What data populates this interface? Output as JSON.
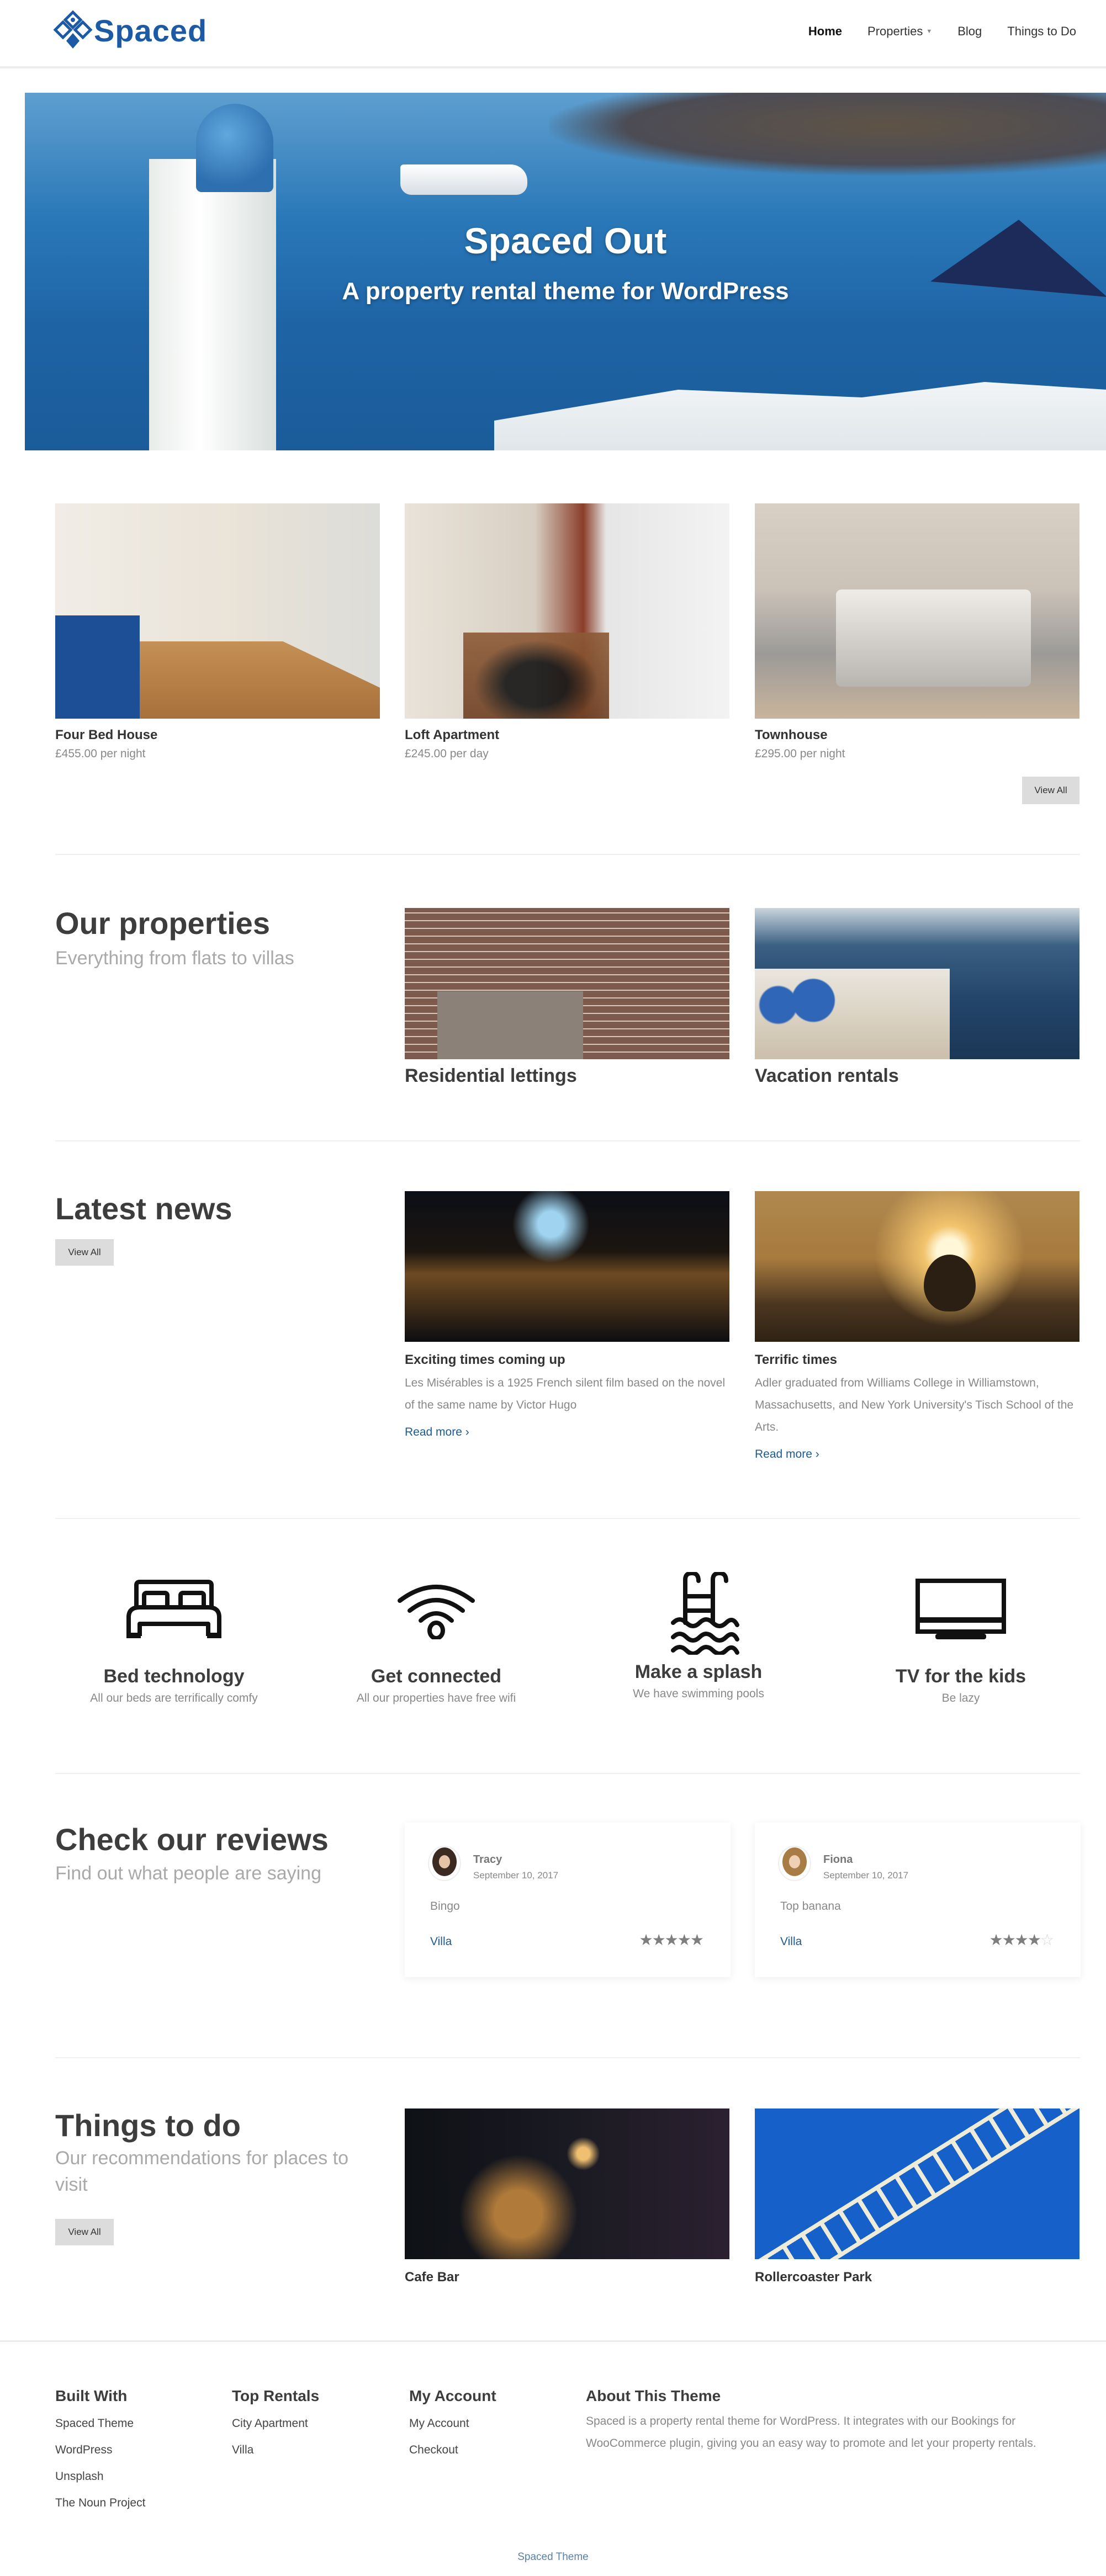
{
  "header": {
    "brand": "Spaced",
    "nav": [
      {
        "label": "Home",
        "active": true
      },
      {
        "label": "Properties",
        "has_dropdown": true
      },
      {
        "label": "Blog"
      },
      {
        "label": "Things to Do"
      }
    ],
    "dropdown_icon": "caret-down-icon"
  },
  "hero": {
    "title": "Spaced Out",
    "subtitle": "A property rental theme for WordPress"
  },
  "featured_properties": {
    "items": [
      {
        "title": "Four Bed House",
        "price": "£455.00 per night"
      },
      {
        "title": "Loft Apartment",
        "price": "£245.00 per day"
      },
      {
        "title": "Townhouse",
        "price": "£295.00 per night"
      }
    ],
    "view_all": "View All"
  },
  "our_properties": {
    "title": "Our properties",
    "subtitle": "Everything from flats to villas",
    "categories": [
      {
        "title": "Residential lettings"
      },
      {
        "title": "Vacation rentals"
      }
    ]
  },
  "latest_news": {
    "title": "Latest news",
    "view_all": "View All",
    "posts": [
      {
        "title": "Exciting times coming up",
        "excerpt": "Les Misérables is a 1925 French silent film based on the novel of the same name by Victor Hugo",
        "read_more": "Read more"
      },
      {
        "title": "Terrific times",
        "excerpt": "Adler graduated from Williams College in Williamstown, Massachusetts, and New York University's Tisch School of the Arts.",
        "read_more": "Read more"
      }
    ],
    "read_more_icon": "chevron-right-icon"
  },
  "features": [
    {
      "icon": "bed-icon",
      "title": "Bed technology",
      "subtitle": "All our beds are terrifically comfy"
    },
    {
      "icon": "wifi-icon",
      "title": "Get connected",
      "subtitle": "All our properties have free wifi"
    },
    {
      "icon": "pool-ladder-icon",
      "title": "Make a splash",
      "subtitle": "We have swimming pools"
    },
    {
      "icon": "tv-icon",
      "title": "TV for the kids",
      "subtitle": "Be lazy"
    }
  ],
  "reviews": {
    "title": "Check our reviews",
    "subtitle": "Find out what people are saying",
    "items": [
      {
        "name": "Tracy",
        "date": "September 10, 2017",
        "text": "Bingo",
        "property": "Villa",
        "rating": 5,
        "max_rating": 5
      },
      {
        "name": "Fiona",
        "date": "September 10, 2017",
        "text": "Top banana",
        "property": "Villa",
        "rating": 4,
        "max_rating": 5
      }
    ]
  },
  "things_to_do": {
    "title": "Things to do",
    "subtitle": "Our recommendations for places to visit",
    "view_all": "View All",
    "items": [
      {
        "title": "Cafe Bar"
      },
      {
        "title": "Rollercoaster Park"
      }
    ]
  },
  "footer": {
    "columns": [
      {
        "heading": "Built With",
        "links": [
          "Spaced Theme",
          "WordPress",
          "Unsplash",
          "The Noun Project"
        ]
      },
      {
        "heading": "Top Rentals",
        "links": [
          "City Apartment",
          "Villa"
        ]
      },
      {
        "heading": "My Account",
        "links": [
          "My Account",
          "Checkout"
        ]
      }
    ],
    "about": {
      "heading": "About This Theme",
      "text": "Spaced is a property rental theme for WordPress. It integrates with our Bookings for WooCommerce plugin, giving you an easy way to promote and let your property rentals."
    },
    "copyright": "Spaced Theme"
  },
  "colors": {
    "brand": "#1d5aa6",
    "link": "#1d5a8f",
    "heading": "#3d3d3d",
    "muted": "#888888",
    "button_bg": "#dcdcdc"
  }
}
